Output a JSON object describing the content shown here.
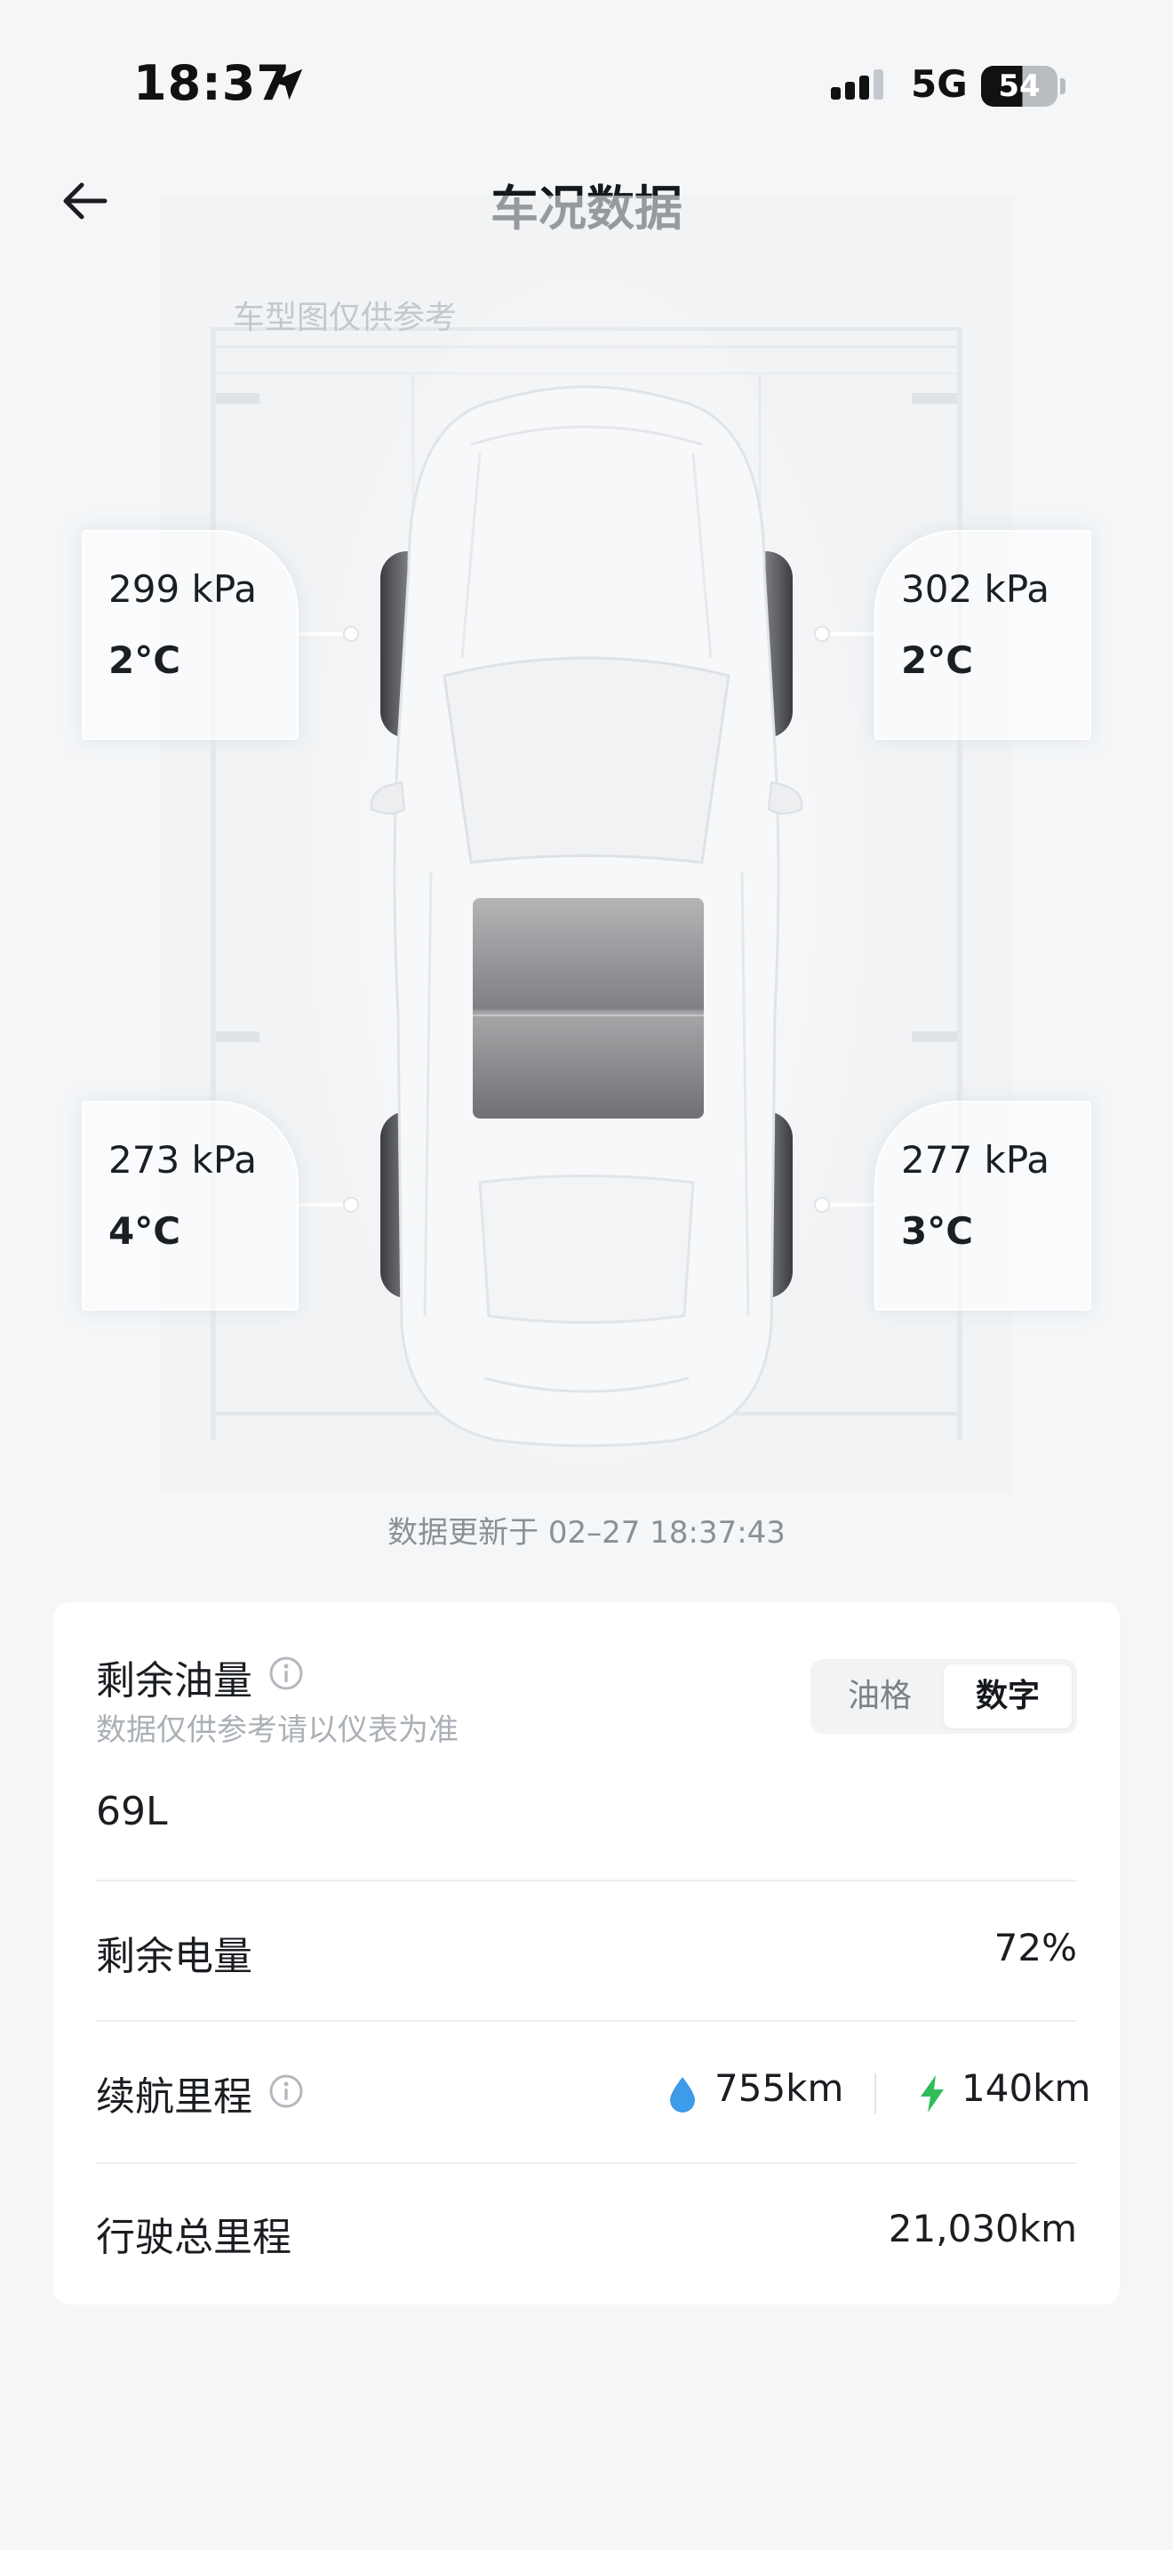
{
  "status_bar": {
    "time": "18:37",
    "network": "5G",
    "battery": "54"
  },
  "header": {
    "title": "车况数据",
    "back_icon": "back-arrow-icon"
  },
  "vehicle": {
    "disclaimer": "车型图仅供参考",
    "tires": {
      "front_left": {
        "pressure": "299 kPa",
        "temp": "2°C"
      },
      "front_right": {
        "pressure": "302 kPa",
        "temp": "2°C"
      },
      "rear_left": {
        "pressure": "273 kPa",
        "temp": "4°C"
      },
      "rear_right": {
        "pressure": "277 kPa",
        "temp": "3°C"
      }
    },
    "update_time": "数据更新于 02–27 18:37:43"
  },
  "info": {
    "fuel": {
      "label": "剩余油量",
      "note": "数据仅供参考请以仪表为准",
      "toggle": [
        "油格",
        "数字"
      ],
      "selected": "数字",
      "value": "69L"
    },
    "battery": {
      "label": "剩余电量",
      "value": "72%"
    },
    "range": {
      "label": "续航里程",
      "fuel_range": "755km",
      "electric_range": "140km",
      "fuel_icon": "water-drop-icon",
      "electric_icon": "lightning-bolt-icon"
    },
    "odometer": {
      "label": "行驶总里程",
      "value": "21,030km"
    }
  },
  "colors": {
    "background": "#f4f6f8",
    "card": "#ffffff",
    "fuel_drop": "#3d9be9",
    "electric_bolt": "#2ebd59"
  }
}
